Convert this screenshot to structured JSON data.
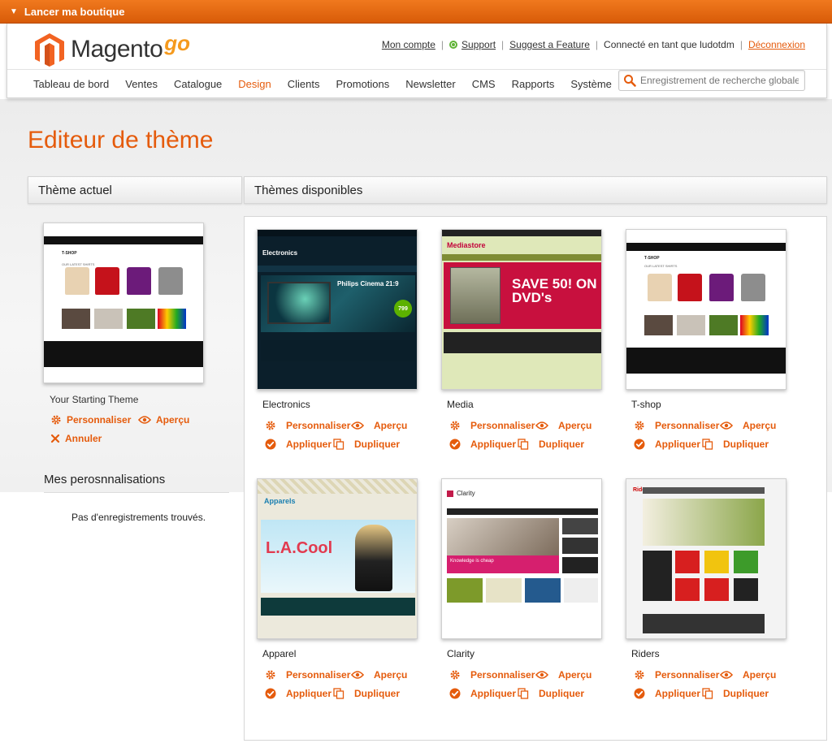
{
  "topbar": {
    "label": "Lancer ma boutique"
  },
  "header": {
    "logo_text": "Magento",
    "logo_suffix": "go",
    "links": {
      "account": "Mon compte",
      "support": "Support",
      "feature": "Suggest a Feature",
      "connected": "Connecté en tant que ludotdm",
      "logout": "Déconnexion"
    },
    "nav": [
      "Tableau de bord",
      "Ventes",
      "Catalogue",
      "Design",
      "Clients",
      "Promotions",
      "Newsletter",
      "CMS",
      "Rapports",
      "Système"
    ],
    "nav_active": "Design",
    "search_placeholder": "Enregistrement de recherche globale"
  },
  "page": {
    "title": "Editeur de thème"
  },
  "current": {
    "heading": "Thème actuel",
    "theme_name": "Your Starting Theme",
    "customize": "Personnaliser",
    "preview": "Aperçu",
    "cancel": "Annuler"
  },
  "customizations": {
    "heading": "Mes perosnnalisations",
    "empty": "Pas d'enregistrements trouvés."
  },
  "available": {
    "heading": "Thèmes disponibles",
    "actions": {
      "customize": "Personnaliser",
      "preview": "Aperçu",
      "apply": "Appliquer",
      "duplicate": "Dupliquer"
    },
    "themes": [
      {
        "name": "Electronics",
        "thumb_text": "Electronics",
        "headline": "Philips Cinema 21:9",
        "price": "799"
      },
      {
        "name": "Media",
        "thumb_text": "Mediastore",
        "headline": "SAVE 50! ON DVD's",
        "price": ""
      },
      {
        "name": "T-shop",
        "thumb_text": "T-SHOP",
        "headline": "OUR LATEST SHIRTS",
        "price": ""
      },
      {
        "name": "Apparel",
        "thumb_text": "Apparels",
        "headline": "L.A.Cool",
        "price": ""
      },
      {
        "name": "Clarity",
        "thumb_text": "Clarity",
        "headline": "Knowledge is cheap",
        "price": ""
      },
      {
        "name": "Riders",
        "thumb_text": "Riders",
        "headline": "",
        "price": ""
      }
    ]
  },
  "colors": {
    "accent": "#e55b0c",
    "topbar": "#e66e14"
  }
}
